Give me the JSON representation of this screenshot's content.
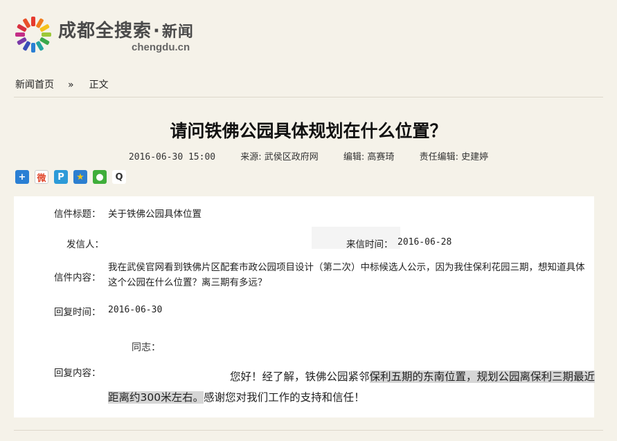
{
  "site": {
    "name": "成都全搜索",
    "dot": "·",
    "section": "新闻",
    "domain": "chengdu.cn"
  },
  "breadcrumb": {
    "home": "新闻首页",
    "separator": "»",
    "current": "正文"
  },
  "article": {
    "title": "请问铁佛公园具体规划在什么位置？",
    "date": "2016-06-30 15:00",
    "source": "来源: 武侯区政府网",
    "editor": "编辑: 高赛琦",
    "chief_editor": "责任编辑: 史建婷"
  },
  "share_icons": [
    {
      "name": "plus-share-icon",
      "color": "#2a7fd4",
      "glyph": "+"
    },
    {
      "name": "weibo-icon",
      "color": "#e0452a",
      "glyph": "微"
    },
    {
      "name": "tencent-weibo-icon",
      "color": "#2c9ad8",
      "glyph": "P"
    },
    {
      "name": "qzone-icon",
      "color": "#f2b515",
      "glyph": "★"
    },
    {
      "name": "wechat-icon",
      "color": "#3fae3a",
      "glyph": "●"
    },
    {
      "name": "qq-icon",
      "color": "#333333",
      "glyph": "Q"
    }
  ],
  "letter": {
    "subject_label": "信件标题：",
    "subject": "关于铁佛公园具体位置",
    "sender_label": "发信人：",
    "sender": "",
    "received_label": "来信时间：",
    "received": "2016-06-28",
    "content_label": "信件内容：",
    "content": "我在武侯官网看到铁佛片区配套市政公园项目设计（第二次）中标候选人公示，因为我住保利花园三期，想知道具体这个公园在什么位置？离三期有多远？",
    "reply_time_label": "回复时间：",
    "reply_time": "2016-06-30",
    "reply_label": "回复内容：",
    "greeting": "同志：",
    "reply_part1": "您好！经了解，铁佛公园紧邻",
    "reply_highlight1": "保利五期的东南位置，规划公园离保利三期最近距离约300米左右。",
    "reply_part2": "感谢您对我们工作的支持和信任！"
  },
  "colors": {
    "page_bg": "#f5f2e9",
    "panel_bg": "#ffffff",
    "highlight": "#d6d6d6"
  }
}
